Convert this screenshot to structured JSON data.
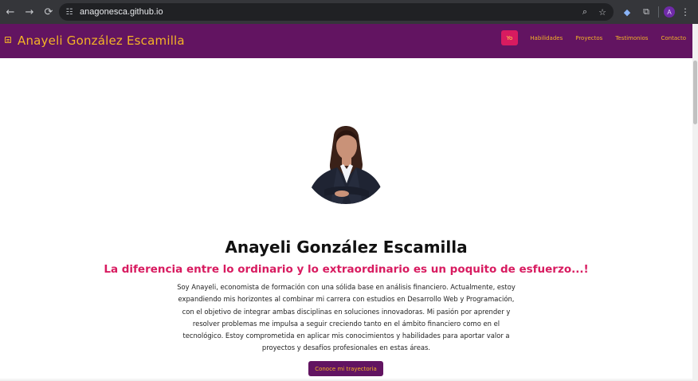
{
  "browser": {
    "url": "anagonesca.github.io",
    "profile_initial": "A"
  },
  "site": {
    "brand": "Anayeli González Escamilla",
    "nav": [
      "Yo",
      "Habilidades",
      "Proyectos",
      "Testimonios",
      "Contacto"
    ],
    "active_nav": "Yo"
  },
  "hero": {
    "name": "Anayeli González Escamilla",
    "tagline": "La diferencia entre lo ordinario y lo extraordinario es un poquito de esfuerzo...!",
    "bio": "Soy Anayeli, economista de formación con una sólida base en análisis financiero. Actualmente, estoy expandiendo mis horizontes al combinar mi carrera con estudios en Desarrollo Web y Programación, con el objetivo de integrar ambas disciplinas en soluciones innovadoras. Mi pasión por aprender y resolver problemas me impulsa a seguir creciendo tanto en el ámbito financiero como en el tecnológico. Estoy comprometida en aplicar mis conocimientos y habilidades para aportar valor a proyectos y desafíos profesionales en estas áreas.",
    "cta_label": "Conoce mi trayectoria"
  },
  "colors": {
    "navbar": "#621461",
    "accent": "#f4b426",
    "highlight": "#d81b60"
  },
  "icons": {
    "back": "arrow-left-icon",
    "forward": "arrow-right-icon",
    "reload": "reload-icon",
    "site_info": "site-info-icon",
    "zoom": "zoom-icon",
    "bookmark": "star-icon",
    "extension": "extension-icon",
    "extensions": "puzzle-icon",
    "menu": "kebab-icon",
    "nav_toggle": "hamburger-icon"
  }
}
